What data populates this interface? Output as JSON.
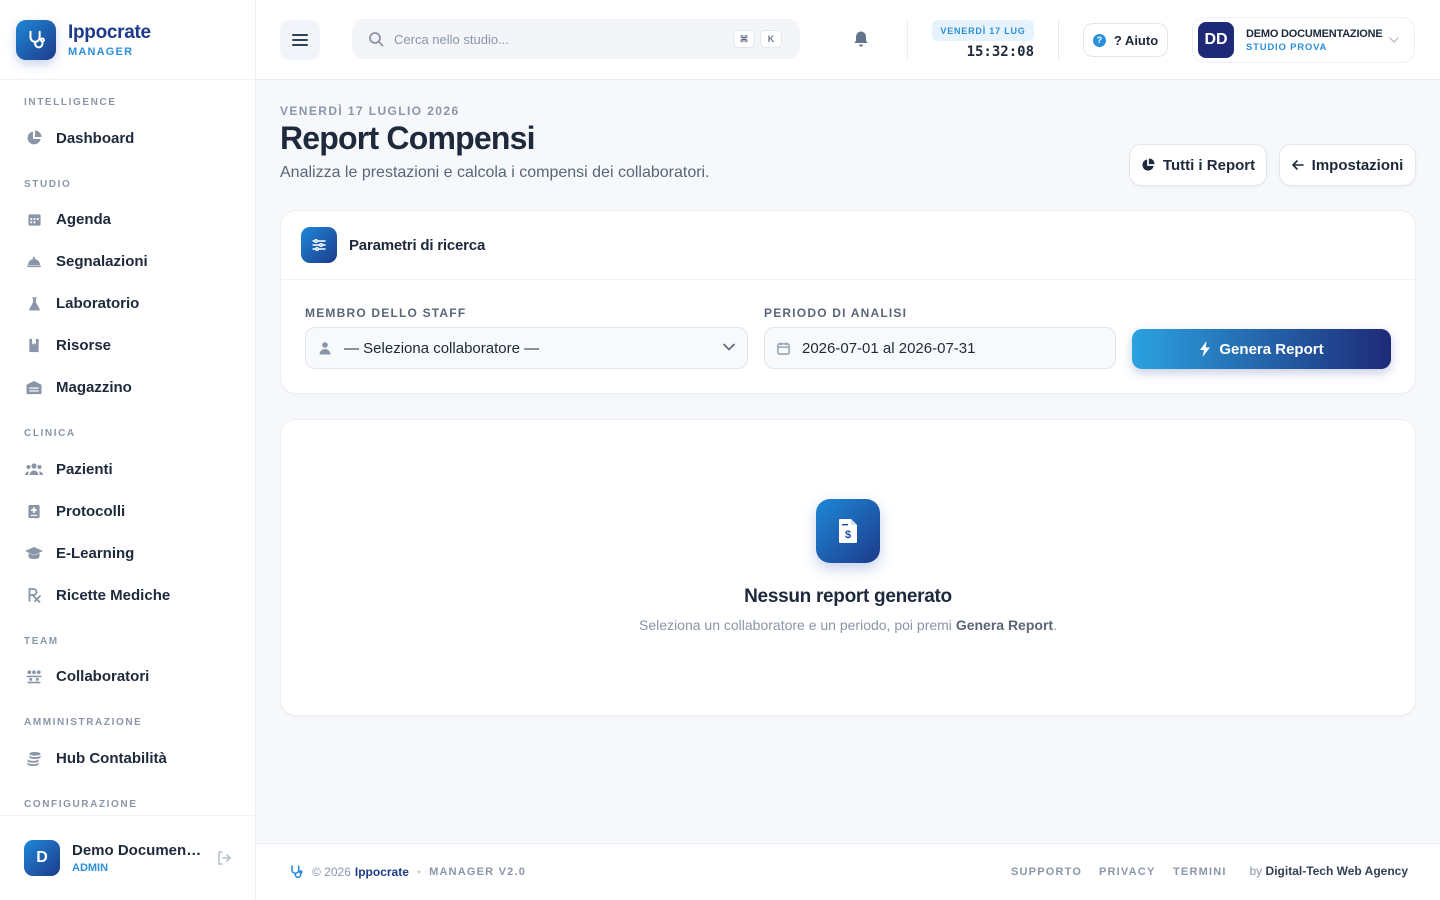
{
  "brand": {
    "name": "Ippocrate",
    "sub": "MANAGER"
  },
  "sidebar": {
    "sections": [
      {
        "label": "INTELLIGENCE",
        "items": [
          {
            "label": "Dashboard",
            "icon": "pie-chart-icon"
          }
        ]
      },
      {
        "label": "STUDIO",
        "items": [
          {
            "label": "Agenda",
            "icon": "calendar-icon"
          },
          {
            "label": "Segnalazioni",
            "icon": "bell-cloche-icon"
          },
          {
            "label": "Laboratorio",
            "icon": "flask-icon"
          },
          {
            "label": "Risorse",
            "icon": "bookmark-icon"
          },
          {
            "label": "Magazzino",
            "icon": "warehouse-icon"
          }
        ]
      },
      {
        "label": "CLINICA",
        "items": [
          {
            "label": "Pazienti",
            "icon": "users-icon"
          },
          {
            "label": "Protocolli",
            "icon": "medical-file-icon"
          },
          {
            "label": "E-Learning",
            "icon": "graduation-cap-icon"
          },
          {
            "label": "Ricette Mediche",
            "icon": "prescription-icon"
          }
        ]
      },
      {
        "label": "TEAM",
        "items": [
          {
            "label": "Collaboratori",
            "icon": "team-icon"
          }
        ]
      },
      {
        "label": "AMMINISTRAZIONE",
        "items": [
          {
            "label": "Hub Contabilità",
            "icon": "coins-icon"
          }
        ]
      },
      {
        "label": "CONFIGURAZIONE",
        "items": []
      }
    ],
    "user": {
      "initial": "D",
      "name": "Demo Documentazione",
      "role": "ADMIN"
    }
  },
  "topbar": {
    "search_placeholder": "Cerca nello studio...",
    "kbd": [
      "⌘",
      "K"
    ],
    "date_badge": "VENERDÌ 17 LUG",
    "clock": "15:32:08",
    "help": "? Aiuto",
    "user": {
      "initials": "DD",
      "name": "DEMO DOCUMENTAZIONE",
      "org": "STUDIO PROVA"
    }
  },
  "page": {
    "date": "VENERDÌ 17 LUGLIO 2026",
    "title": "Report Compensi",
    "subtitle": "Analizza le prestazioni e calcola i compensi dei collaboratori.",
    "btn_reports": "Tutti i Report",
    "btn_settings": "Impostazioni"
  },
  "params": {
    "title": "Parametri di ricerca",
    "staff_label": "MEMBRO DELLO STAFF",
    "staff_value": "— Seleziona collaboratore —",
    "period_label": "PERIODO DI ANALISI",
    "period_value": "2026-07-01 al 2026-07-31",
    "generate": "Genera Report"
  },
  "empty": {
    "title": "Nessun report generato",
    "sub_before": "Seleziona un collaboratore e un periodo, poi premi ",
    "sub_bold": "Genera Report",
    "sub_after": "."
  },
  "footer": {
    "copyright": "© 2026",
    "brand": "Ippocrate",
    "version": "MANAGER V2.0",
    "links": [
      "SUPPORTO",
      "PRIVACY",
      "TERMINI"
    ],
    "by": "by",
    "agency": "Digital-Tech Web Agency"
  },
  "colors": {
    "accent": "#2b90d9",
    "brand_dark": "#1e3a8a",
    "text": "#1e293b",
    "muted": "#8a96a8"
  }
}
